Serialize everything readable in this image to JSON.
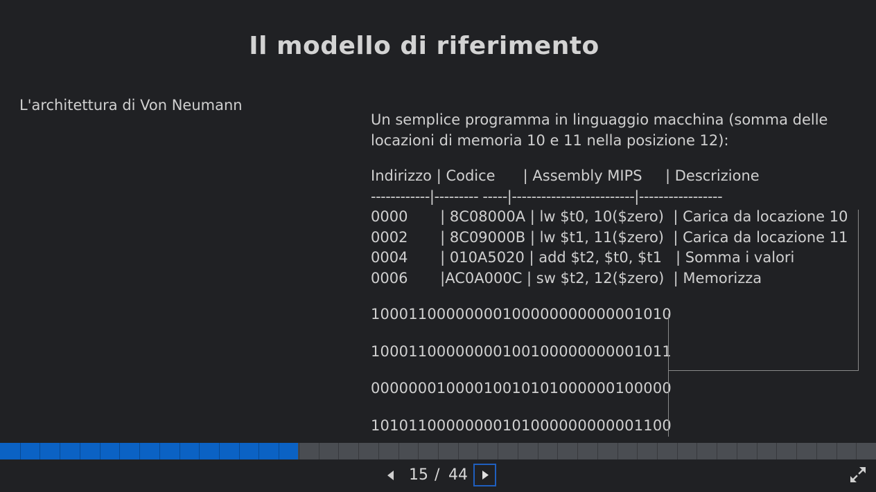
{
  "slide": {
    "title": "Il modello di riferimento",
    "left_label": "L'architettura di Von Neumann",
    "intro_line1": "Un semplice programma in linguaggio macchina (somma delle",
    "intro_line2": "locazioni di memoria 10 e 11 nella posizione 12):",
    "table_header": "Indirizzo | Codice      | Assembly MIPS     | Descrizione",
    "table_separator": "------------|--------- -----|-------------------------|-----------------",
    "table_rows": [
      "0000       | 8C08000A | lw $t0, 10($zero)  | Carica da locazione 10",
      "0002       | 8C09000B | lw $t1, 11($zero)  | Carica da locazione 11",
      "0004       | 010A5020 | add $t2, $t0, $t1   | Somma i valori",
      "0006       |AC0A000C | sw $t2, 12($zero)  | Memorizza"
    ],
    "binary_rows": [
      "10001100000000100000000000001010",
      "10001100000000100100000000001011",
      "00000001000010010101000000100000",
      "10101100000000101000000000001100"
    ]
  },
  "navigation": {
    "current_page": "15",
    "separator": "/",
    "total_pages": "44",
    "progress": 0.34,
    "prev_icon": "triangle-left",
    "next_icon": "triangle-right",
    "fullscreen_icon": "expand-arrows"
  },
  "colors": {
    "background": "#202124",
    "text": "#d8d8d8",
    "progress_fill": "#0b62c4",
    "progress_track": "#4a4d52",
    "accent_border": "#1f5fbf"
  }
}
